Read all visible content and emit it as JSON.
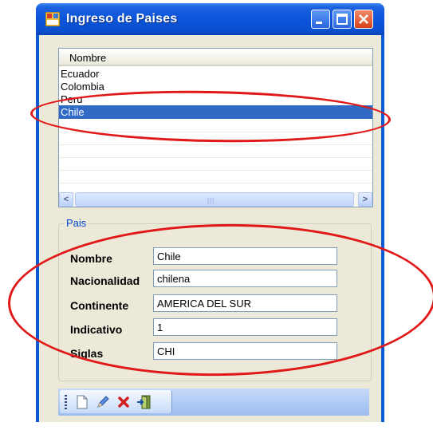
{
  "window": {
    "title": "Ingreso de Paises"
  },
  "list": {
    "column_header": "Nombre",
    "items": [
      "Ecuador",
      "Colombia",
      "Peru",
      "Chile"
    ],
    "selected": "Chile"
  },
  "group": {
    "label": "Pais",
    "fields": [
      {
        "label": "Nombre",
        "value": "Chile"
      },
      {
        "label": "Nacionalidad",
        "value": "chilena"
      },
      {
        "label": "Continente",
        "value": "AMERICA DEL SUR"
      },
      {
        "label": "Indicativo",
        "value": "1"
      },
      {
        "label": "Siglas",
        "value": "CHI"
      }
    ]
  },
  "toolbar": {
    "icons": [
      "new-icon",
      "edit-icon",
      "delete-icon",
      "exit-icon"
    ]
  },
  "colors": {
    "title_bar": "#0a55da",
    "selection": "#316ac5",
    "annotation": "#e11818",
    "group_label": "#0046d5"
  }
}
